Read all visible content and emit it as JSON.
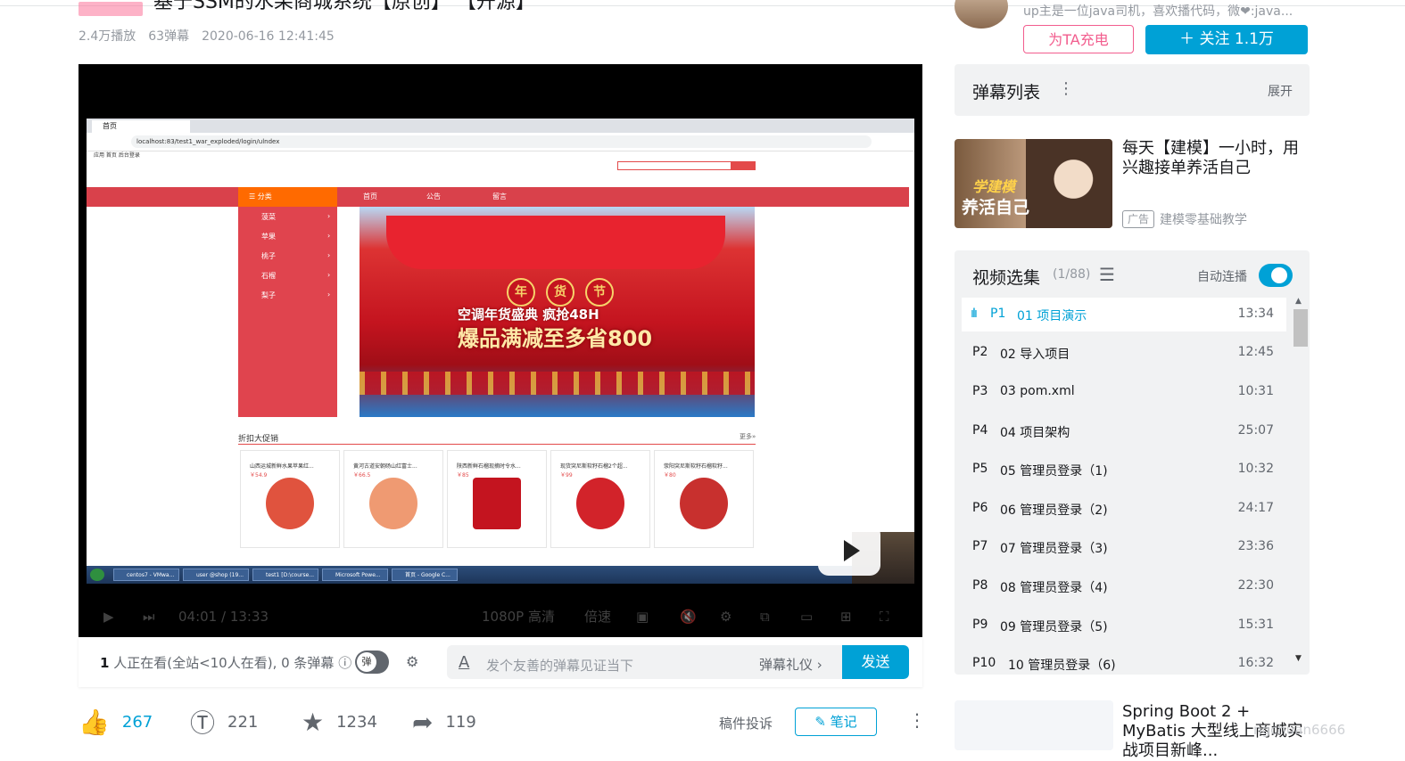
{
  "video": {
    "title": "基于SSM的水果商城系统【原创】 【开源】",
    "tag": "原创",
    "views": "2.4万播放",
    "danmaku_count": "63弹幕",
    "date": "2020-06-16 12:41:45"
  },
  "browser": {
    "tab": "首页",
    "url": "localhost:83/test1_war_exploded/login/ulndex",
    "bookmarks": "应用   首页   后台登录"
  },
  "site": {
    "nav": [
      "分类",
      "首页",
      "公告",
      "留言"
    ],
    "categories": [
      "菠菜",
      "苹果",
      "桃子",
      "石榴",
      "梨子"
    ],
    "banner_chars": [
      "年",
      "货",
      "节"
    ],
    "banner_line1": "空调年货盛典 疯抢48H",
    "banner_line2": "爆品满减至多省800",
    "promo_title": "折扣大促销",
    "promo_more": "更多»",
    "products": [
      {
        "title": "山西运城新鲜水果苹果红...",
        "price": "￥54.9",
        "color": "#e0533e"
      },
      {
        "title": "黄河古道安朝砀山红富士...",
        "price": "￥66.5",
        "color": "#ef9a72"
      },
      {
        "title": "陕西新鲜石榴现摘时令水...",
        "price": "￥85",
        "color": "#c4141f"
      },
      {
        "title": "现货突尼斯软籽石榴2个超...",
        "price": "￥99",
        "color": "#d2232a"
      },
      {
        "title": "荥阳突尼斯软籽石榴软籽...",
        "price": "￥80",
        "color": "#c8302e"
      }
    ],
    "taskbar": [
      "centos7 - VMwa...",
      "user @shop (19...",
      "test1 [D:\\course...",
      "Microsoft Powe...",
      "首页 - Google C..."
    ]
  },
  "player": {
    "time": "04:01 / 13:33",
    "quality": "1080P 高清",
    "speed": "倍速"
  },
  "danmaku_bar": {
    "viewers_count": "1",
    "viewers_text": "人正在看(全站<10人在看), 0 条弹幕",
    "toggle_label": "弹",
    "placeholder": "发个友善的弹幕见证当下",
    "etiquette": "弹幕礼仪 ›",
    "send": "发送"
  },
  "actions": {
    "likes": "267",
    "coins": "221",
    "favorites": "1234",
    "shares": "119",
    "complaint": "稿件投诉",
    "notes": "笔记"
  },
  "uploader": {
    "desc": "up主是一位java司机，喜欢播代码，微❤:java...",
    "charge": "为TA充电",
    "follow": "关注 1.1万"
  },
  "danmaku_list": {
    "title": "弹幕列表",
    "expand": "展开"
  },
  "ad": {
    "img_text1": "学建模",
    "img_text2": "养活自己",
    "title": "每天【建模】一小时，用兴趣接单养活自己",
    "tag": "广告",
    "source": "建模零基础教学"
  },
  "episodes": {
    "title": "视频选集",
    "count": "(1/88)",
    "autoplay": "自动连播",
    "items": [
      {
        "num": "P1",
        "name": "01 项目演示",
        "dur": "13:34"
      },
      {
        "num": "P2",
        "name": "02 导入项目",
        "dur": "12:45"
      },
      {
        "num": "P3",
        "name": "03 pom.xml",
        "dur": "10:31"
      },
      {
        "num": "P4",
        "name": "04 项目架构",
        "dur": "25:07"
      },
      {
        "num": "P5",
        "name": "05 管理员登录（1)",
        "dur": "10:32"
      },
      {
        "num": "P6",
        "name": "06 管理员登录（2)",
        "dur": "24:17"
      },
      {
        "num": "P7",
        "name": "07 管理员登录（3)",
        "dur": "23:36"
      },
      {
        "num": "P8",
        "name": "08 管理员登录（4)",
        "dur": "22:30"
      },
      {
        "num": "P9",
        "name": "09 管理员登录（5)",
        "dur": "15:31"
      },
      {
        "num": "P10",
        "name": "10 管理员登录（6)",
        "dur": "16:32"
      }
    ]
  },
  "recommend": {
    "title": "Spring Boot 2 + MyBatis 大型线上商城实战项目新峰..."
  },
  "watermark": "ngchuan6666"
}
